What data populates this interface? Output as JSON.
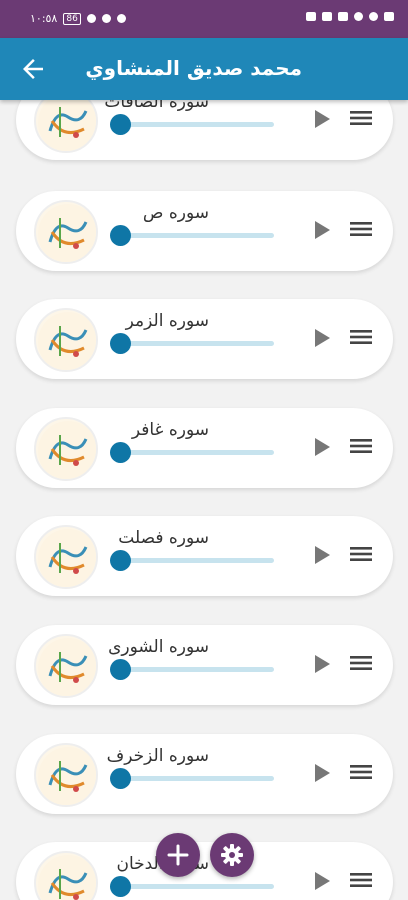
{
  "status_bar": {
    "time": "١٠:٥٨",
    "battery": "86"
  },
  "app_bar": {
    "title": "محمد صديق المنشاوي"
  },
  "surahs": [
    {
      "label": "سوره الصافات",
      "progress": 0
    },
    {
      "label": "سوره ص",
      "progress": 0
    },
    {
      "label": "سوره الزمر",
      "progress": 0
    },
    {
      "label": "سوره غافر",
      "progress": 0
    },
    {
      "label": "سوره فصلت",
      "progress": 0
    },
    {
      "label": "سوره الشورى",
      "progress": 0
    },
    {
      "label": "سوره الزخرف",
      "progress": 0
    },
    {
      "label": "سوره الدخان",
      "progress": 0
    }
  ],
  "colors": {
    "app_bar": "#1f87b8",
    "status_bar": "#6b3a74",
    "thumb": "#0f76a6",
    "track": "#c7e3ee",
    "fab": "#6b3a74"
  },
  "icons": {
    "back": "arrow-left-icon",
    "play": "play-icon",
    "menu": "menu-icon",
    "add": "plus-icon",
    "settings": "gear-icon"
  }
}
